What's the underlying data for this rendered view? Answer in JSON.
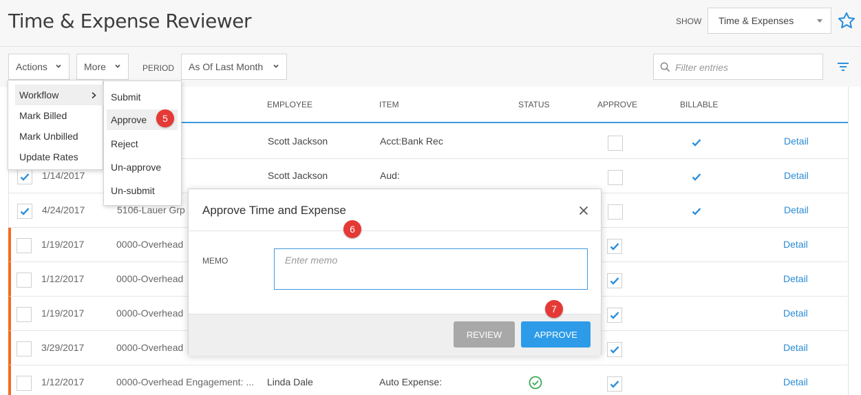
{
  "header": {
    "title": "Time & Expense Reviewer",
    "show_label": "SHOW",
    "show_value": "Time & Expenses",
    "star_icon": "star-outline-icon"
  },
  "toolbar": {
    "actions_label": "Actions",
    "more_label": "More",
    "period_label": "PERIOD",
    "period_value": "As Of Last Month",
    "filter_placeholder": "Filter entries"
  },
  "grid": {
    "columns": {
      "employee": "EMPLOYEE",
      "item": "ITEM",
      "status": "STATUS",
      "approve": "APPROVE",
      "billable": "BILLABLE"
    },
    "rows": [
      {
        "date": "",
        "engagement": "",
        "employee": "Scott Jackson",
        "item": "Acct:Bank Rec",
        "selected": false,
        "approve": false,
        "billable": true,
        "detail": "Detail",
        "flag": false
      },
      {
        "date": "1/14/2017",
        "engagement": "",
        "employee": "Scott Jackson",
        "item": "Aud:",
        "selected": true,
        "approve": false,
        "billable": true,
        "detail": "Detail",
        "flag": false
      },
      {
        "date": "4/24/2017",
        "engagement": "5106-Lauer Grp",
        "employee": "",
        "item": "",
        "selected": true,
        "approve": false,
        "billable": true,
        "detail": "Detail",
        "flag": false
      },
      {
        "date": "1/19/2017",
        "engagement": "0000-Overhead",
        "employee": "",
        "item": "",
        "selected": false,
        "approve": true,
        "billable": false,
        "detail": "Detail",
        "flag": true
      },
      {
        "date": "1/12/2017",
        "engagement": "0000-Overhead",
        "employee": "",
        "item": "",
        "selected": false,
        "approve": true,
        "billable": false,
        "detail": "Detail",
        "flag": true
      },
      {
        "date": "1/19/2017",
        "engagement": "0000-Overhead",
        "employee": "",
        "item": "",
        "selected": false,
        "approve": true,
        "billable": false,
        "detail": "Detail",
        "flag": true
      },
      {
        "date": "3/29/2017",
        "engagement": "0000-Overhead",
        "employee": "",
        "item": "",
        "selected": false,
        "approve": true,
        "billable": false,
        "detail": "Detail",
        "flag": true
      },
      {
        "date": "1/12/2017",
        "engagement": "0000-Overhead Engagement: ...",
        "employee": "Linda Dale",
        "item": "Auto Expense:",
        "selected": false,
        "approve": true,
        "billable": false,
        "detail": "Detail",
        "flag": true,
        "status_icon": "check-circle-icon"
      }
    ]
  },
  "actions_menu": {
    "items": [
      "Workflow",
      "Mark Billed",
      "Mark Unbilled",
      "Update Rates"
    ]
  },
  "workflow_menu": {
    "items": [
      "Submit",
      "Approve",
      "Reject",
      "Un-approve",
      "Un-submit"
    ]
  },
  "badges": {
    "b5": "5",
    "b6": "6",
    "b7": "7"
  },
  "dialog": {
    "title": "Approve Time and Expense",
    "memo_label": "MEMO",
    "memo_placeholder": "Enter memo",
    "review_label": "REVIEW",
    "approve_label": "APPROVE"
  },
  "colors": {
    "accent": "#2d9be8",
    "flag": "#f26b21",
    "badge": "#e53935",
    "status_ok": "#3aa856"
  }
}
